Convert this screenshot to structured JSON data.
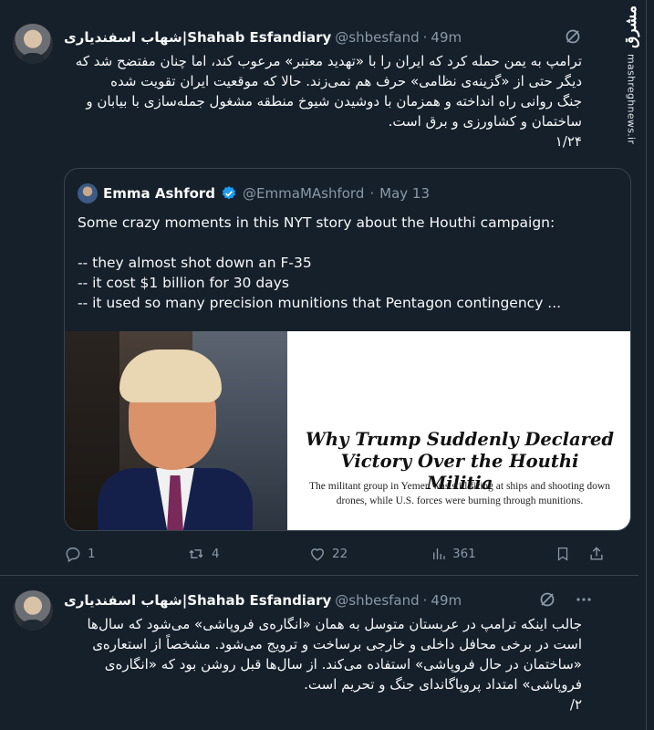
{
  "watermark": {
    "logo": "مشرق",
    "url": "mashreghnews.ir"
  },
  "tweets": [
    {
      "display_name": "شهاب اسفندیاری|Shahab Esfandiary",
      "handle": "@shbesfand",
      "separator": "·",
      "time": "49m",
      "lines": [
        "ترامپ به یمن حمله کرد که ایران را با «تهدید معتبر» مرعوب کند، اما چنان مفتضح شد که",
        "دیگر حتی از «گزینه‌ی نظامی» حرف هم نمی‌زند. حالا که موقعیت ایران تقویت شده",
        "جنگ روانی راه انداخته و همزمان با دوشیدن شیوخ منطقه مشغول جمله‌سازی با بیابان و",
        "ساختمان و کشاورزی و برق است.",
        "۱/۲۴"
      ],
      "quote": {
        "display_name": "Emma Ashford",
        "handle": "@EmmaMAshford",
        "separator": "·",
        "date": "May 13",
        "lines": [
          "Some crazy moments in this NYT story about the Houthi campaign:",
          "",
          "-- they almost shot down an F-35",
          "-- it cost $1 billion for 30 days",
          "-- it used so many precision munitions that Pentagon contingency ..."
        ],
        "card": {
          "headline": "Why Trump Suddenly Declared Victory Over the Houthi Militia",
          "subhead": "The militant group in Yemen was still firing at ships and shooting down drones, while U.S. forces were burning through munitions."
        }
      },
      "actions": {
        "replies": "1",
        "reposts": "4",
        "likes": "22",
        "views": "361"
      }
    },
    {
      "display_name": "شهاب اسفندیاری|Shahab Esfandiary",
      "handle": "@shbesfand",
      "separator": "·",
      "time": "49m",
      "lines": [
        "جالب اینکه ترامپ در عربستان متوسل به همان «انگاره‌ی فروپاشی» می‌شود که سال‌ها",
        "است در برخی محافل داخلی و خارجی برساخت و ترویج می‌شود. مشخصاً از استعاره‌ی",
        "«ساختمان در حال فروپاشی» استفاده می‌کند. از سال‌ها قبل روشن بود که «انگاره‌ی",
        "فروپاشی» امتداد پروپاگاندای جنگ و تحریم است.",
        "۲/"
      ]
    }
  ],
  "colors": {
    "background": "#15202b",
    "text": "#f7f9f9",
    "muted": "#8b98a5",
    "border": "#38444d",
    "verified": "#1d9bf0"
  },
  "icons": [
    "grok-icon",
    "more-icon",
    "verified-badge-icon",
    "reply-icon",
    "repost-icon",
    "like-icon",
    "views-icon",
    "bookmark-icon",
    "share-icon"
  ]
}
